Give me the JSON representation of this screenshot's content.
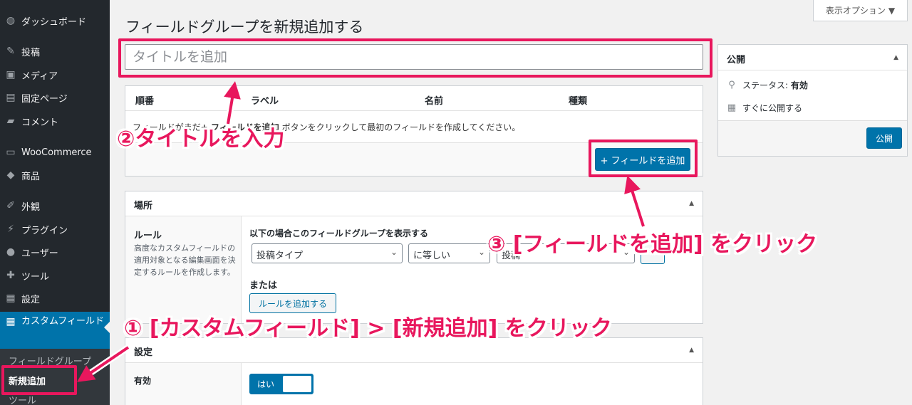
{
  "sidebar": {
    "items": [
      {
        "label": "ダッシュボード",
        "icon": "dashboard-icon",
        "glyph": "◍"
      },
      {
        "label": "投稿",
        "icon": "pin-icon",
        "glyph": "✎"
      },
      {
        "label": "メディア",
        "icon": "media-icon",
        "glyph": "▣"
      },
      {
        "label": "固定ページ",
        "icon": "page-icon",
        "glyph": "▤"
      },
      {
        "label": "コメント",
        "icon": "comment-icon",
        "glyph": "▰"
      },
      {
        "label": "WooCommerce",
        "icon": "woocommerce-icon",
        "glyph": "▭"
      },
      {
        "label": "商品",
        "icon": "product-icon",
        "glyph": "◆"
      },
      {
        "label": "外観",
        "icon": "appearance-icon",
        "glyph": "✐"
      },
      {
        "label": "プラグイン",
        "icon": "plugin-icon",
        "glyph": "⚡"
      },
      {
        "label": "ユーザー",
        "icon": "user-icon",
        "glyph": "●"
      },
      {
        "label": "ツール",
        "icon": "tool-icon",
        "glyph": "✚"
      },
      {
        "label": "設定",
        "icon": "settings-icon",
        "glyph": "▦"
      },
      {
        "label": "カスタムフィールド",
        "icon": "custom-fields-icon",
        "glyph": "▦"
      }
    ],
    "submenu": [
      "フィールドグループ",
      "新規追加",
      "ツール"
    ]
  },
  "header": {
    "title": "フィールドグループを新規追加する",
    "screen_options": "表示オプション"
  },
  "title_input": {
    "placeholder": "タイトルを追加",
    "value": ""
  },
  "fields": {
    "columns": [
      "順番",
      "ラベル",
      "名前",
      "種類"
    ],
    "empty_prefix": "フィールドがまだ",
    "empty_bold": "+ フィールドを追加",
    "empty_suffix": " ボタンをクリックして最初のフィールドを作成してください。",
    "add_button": "+ フィールドを追加"
  },
  "location": {
    "header": "場所",
    "rule_label": "ルール",
    "rule_desc": "高度なカスタムフィールドの適用対象となる編集画面を決定するルールを作成します。",
    "caption": "以下の場合このフィールドグループを表示する",
    "param": "投稿タイプ",
    "operator": "に等しい",
    "value": "投稿",
    "or_label": "または",
    "add_rule_button": "ルールを追加する"
  },
  "settings": {
    "header": "設定",
    "enable_label": "有効",
    "toggle_on": "はい"
  },
  "publish": {
    "header": "公開",
    "status_label": "ステータス: ",
    "status_value": "有効",
    "schedule": "すぐに公開する",
    "button": "公開"
  },
  "annotations": {
    "step1": "① [カスタムフィールド] > [新規追加] をクリック",
    "step2": "②タイトルを入力",
    "step3": "③ [フィールドを追加] をクリック"
  },
  "colors": {
    "accent": "#0073aa",
    "annotation": "#e8175d",
    "sidebar": "#23282d"
  }
}
